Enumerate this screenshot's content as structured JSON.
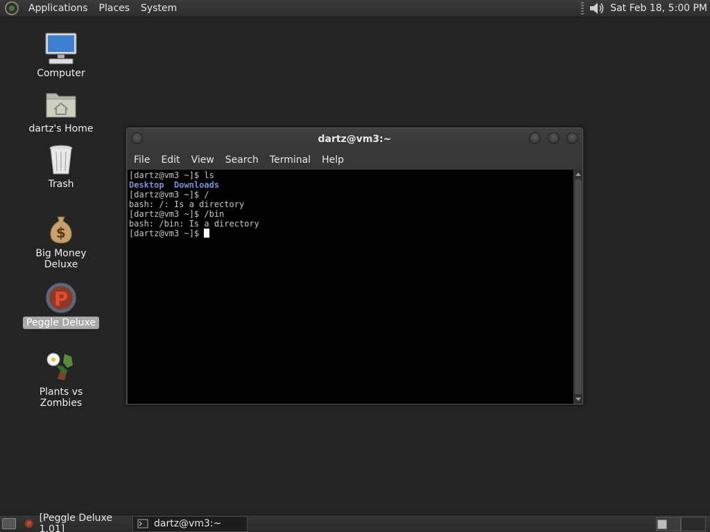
{
  "top_panel": {
    "menus": [
      "Applications",
      "Places",
      "System"
    ],
    "clock": "Sat Feb 18,  5:00 PM"
  },
  "desktop_icons": [
    {
      "label": "Computer",
      "icon": "computer-icon"
    },
    {
      "label": "dartz's Home",
      "icon": "home-folder-icon"
    },
    {
      "label": "Trash",
      "icon": "trash-icon"
    },
    {
      "label": "Big Money Deluxe",
      "icon": "money-bag-icon"
    },
    {
      "label": "Peggle Deluxe",
      "icon": "peggle-icon",
      "selected": true
    },
    {
      "label": "Plants vs Zombies",
      "icon": "plants-vs-zombies-icon"
    }
  ],
  "terminal": {
    "title": "dartz@vm3:~",
    "menus": [
      "File",
      "Edit",
      "View",
      "Search",
      "Terminal",
      "Help"
    ],
    "lines": [
      {
        "prompt": "[dartz@vm3 ~]$ ",
        "cmd": "ls"
      },
      {
        "dirs": [
          "Desktop",
          "Downloads"
        ]
      },
      {
        "prompt": "[dartz@vm3 ~]$ ",
        "cmd": "/"
      },
      {
        "text": "bash: /: Is a directory"
      },
      {
        "prompt": "[dartz@vm3 ~]$ ",
        "cmd": "/bin"
      },
      {
        "text": "bash: /bin: Is a directory"
      },
      {
        "prompt": "[dartz@vm3 ~]$ ",
        "cmd": "",
        "cursor": true
      }
    ]
  },
  "taskbar": {
    "tasks": [
      {
        "label": "[Peggle Deluxe 1.01]",
        "icon": "peggle-icon",
        "active": false
      },
      {
        "label": "dartz@vm3:~",
        "icon": "terminal-icon",
        "active": true
      }
    ]
  },
  "colors": {
    "desktop_bg": "#232423",
    "terminal_bg": "#000000",
    "directory_text": "#7a8fd8"
  }
}
